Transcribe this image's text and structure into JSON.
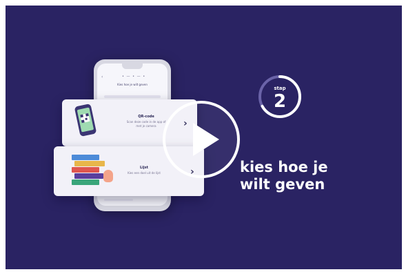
{
  "phone": {
    "back": "‹",
    "steps": "• — • — •",
    "title": "Kies hoe je wilt geven"
  },
  "option_qr": {
    "title": "QR-code",
    "description": "Scan deze code in de app of met je camera",
    "icon": "qr-phone-icon",
    "chevron": "›"
  },
  "option_list": {
    "title": "Lijst",
    "description": "Kies een doel uit de lijst",
    "icon": "books-list-icon",
    "chevron": "›"
  },
  "video": {
    "play_icon": "play-icon"
  },
  "step": {
    "label": "stap",
    "number": "2",
    "progress": 0.67
  },
  "headline": {
    "line1": "kies hoe je",
    "line2": "wilt geven"
  },
  "colors": {
    "background": "#2a2363",
    "card": "#f2f1f8",
    "accent_text": "#ffffff"
  }
}
